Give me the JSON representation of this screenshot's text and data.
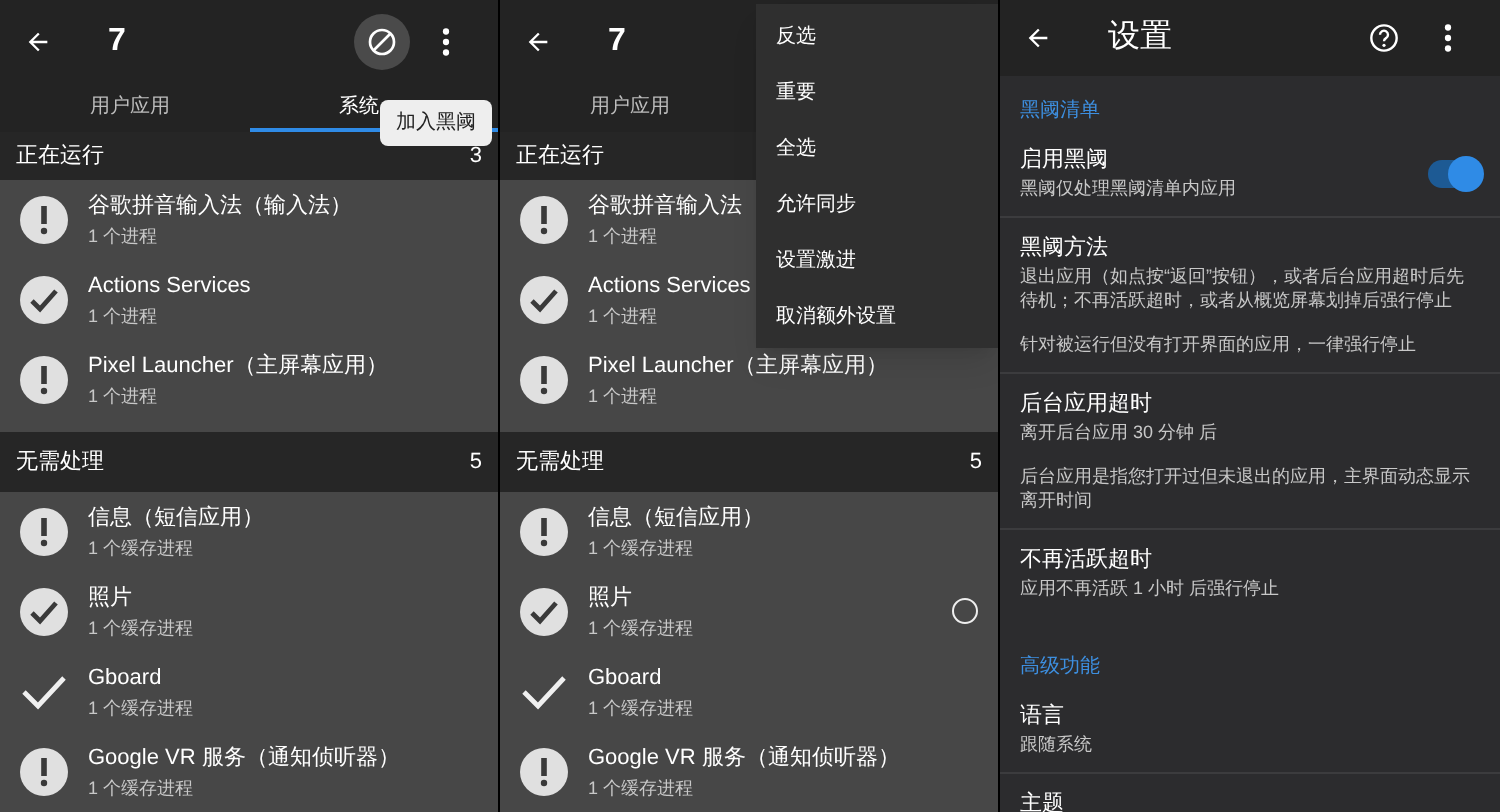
{
  "panels": [
    {
      "kind": "app_list",
      "toolbar": {
        "title": "7",
        "actions": [
          {
            "kind": "block",
            "highlighted": true
          },
          {
            "kind": "more",
            "highlighted": false
          }
        ]
      },
      "tabs": [
        {
          "label": "用户应用",
          "selected": false
        },
        {
          "label": "系统",
          "selected": true
        }
      ],
      "tooltip": "加入黑阈",
      "sections": [
        {
          "title": "正在运行",
          "count": "3",
          "apps": [
            {
              "kind": "warning",
              "name": "谷歌拼音输入法（输入法）",
              "detail": "1 个进程"
            },
            {
              "kind": "checked",
              "name": "Actions Services",
              "detail": "1 个进程"
            },
            {
              "kind": "warning",
              "name": "Pixel Launcher（主屏幕应用）",
              "detail": "1 个进程"
            }
          ]
        },
        {
          "title": "无需处理",
          "count": "5",
          "apps": [
            {
              "kind": "warning",
              "name": "信息（短信应用）",
              "detail": "1 个缓存进程"
            },
            {
              "kind": "checked",
              "name": "照片",
              "detail": "1 个缓存进程"
            },
            {
              "kind": "check",
              "name": "Gboard",
              "detail": "1 个缓存进程"
            },
            {
              "kind": "warning",
              "name": "Google VR 服务（通知侦听器）",
              "detail": "1 个缓存进程"
            }
          ]
        }
      ]
    },
    {
      "kind": "app_list",
      "toolbar": {
        "title": "7"
      },
      "tabs": [
        {
          "label": "用户应用",
          "selected": false
        }
      ],
      "menu": [
        "反选",
        "重要",
        "全选",
        "允许同步",
        "设置激进",
        "取消额外设置"
      ],
      "sections": [
        {
          "title": "正在运行",
          "apps": [
            {
              "kind": "warning",
              "name": "谷歌拼音输入法",
              "detail": "1 个进程"
            },
            {
              "kind": "checked",
              "name": "Actions Services",
              "detail": "1 个进程"
            },
            {
              "kind": "warning",
              "name": "Pixel Launcher（主屏幕应用）",
              "detail": "1 个进程"
            }
          ]
        },
        {
          "title": "无需处理",
          "count": "5",
          "apps": [
            {
              "kind": "warning",
              "name": "信息（短信应用）",
              "detail": "1 个缓存进程"
            },
            {
              "kind": "checked",
              "name": "照片",
              "detail": "1 个缓存进程",
              "selected": false
            },
            {
              "kind": "check",
              "name": "Gboard",
              "detail": "1 个缓存进程"
            },
            {
              "kind": "warning",
              "name": "Google VR 服务（通知侦听器）",
              "detail": "1 个缓存进程"
            }
          ]
        }
      ]
    },
    {
      "kind": "settings",
      "toolbar": {
        "title": "设置",
        "actions": [
          {
            "kind": "help",
            "highlighted": false
          },
          {
            "kind": "more",
            "highlighted": false
          }
        ]
      },
      "groups": [
        {
          "title": "黑阈清单",
          "items": [
            {
              "title": "启用黑阈",
              "summary": [
                "黑阈仅处理黑阈清单内应用"
              ],
              "switch": {
                "on": true
              }
            },
            {
              "title": "黑阈方法",
              "summary": [
                "退出应用（如点按“返回”按钮），或者后台应用超时后先待机；不再活跃超时，或者从概览屏幕划掉后强行停止",
                "针对被运行但没有打开界面的应用，一律强行停止"
              ]
            },
            {
              "title": "后台应用超时",
              "summary": [
                "离开后台应用 30 分钟 后",
                "后台应用是指您打开过但未退出的应用，主界面动态显示离开时间"
              ]
            },
            {
              "title": "不再活跃超时",
              "summary": [
                "应用不再活跃 1 小时 后强行停止"
              ]
            }
          ]
        },
        {
          "title": "高级功能",
          "items": [
            {
              "title": "语言",
              "summary": [
                "跟随系统"
              ]
            },
            {
              "title": "主题"
            }
          ]
        }
      ]
    }
  ]
}
